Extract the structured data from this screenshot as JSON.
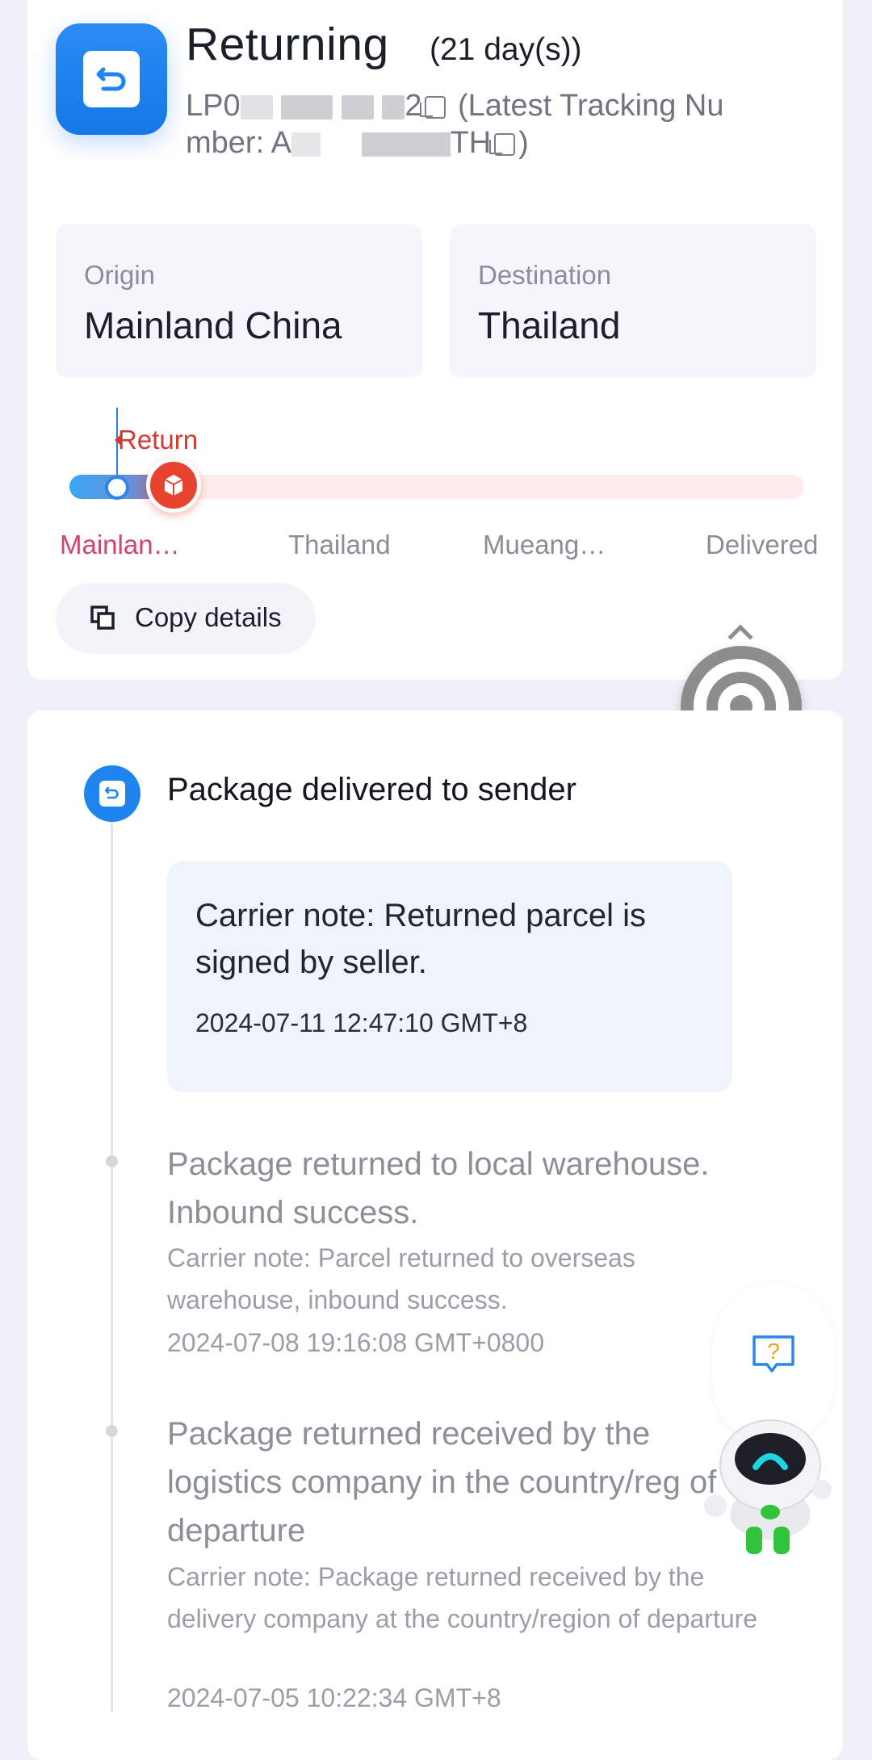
{
  "status": {
    "title": "Returning",
    "days": "(21 day(s))",
    "tracking_prefix": "LP0",
    "tracking_suffix_digit": "2",
    "latest_label": "(Latest Tracking Nu",
    "latest_label_cont": "mber: A",
    "latest_suffix": "TH",
    "latest_close": ")"
  },
  "origin": {
    "label": "Origin",
    "value": "Mainland China"
  },
  "destination": {
    "label": "Destination",
    "value": "Thailand"
  },
  "progress": {
    "fraction": 0.11,
    "return_tag": "Return",
    "stops": [
      "Mainlan…",
      "Thailand",
      "Mueang…",
      "Delivered"
    ],
    "active_color": "#d24467",
    "inactive_color": "#8a8e98"
  },
  "actions": {
    "copy_details": "Copy details"
  },
  "timeline": {
    "current": {
      "title": "Package delivered to sender",
      "note": "Carrier note: Returned parcel is signed by seller.",
      "time": "2024-07-11 12:47:10 GMT+8"
    },
    "events": [
      {
        "title": "Package returned to local warehouse. Inbound success.",
        "note": "Carrier note: Parcel returned to overseas warehouse, inbound success.",
        "time": "2024-07-08 19:16:08 GMT+0800"
      },
      {
        "title": "Package returned received by the logistics company in the country/reg of departure",
        "note": "Carrier note: Package returned received by the delivery company at the country/region of departure",
        "time": "2024-07-05 10:22:34 GMT+8"
      }
    ]
  },
  "colors": {
    "accent": "#1e84ee",
    "return": "#d33a31"
  },
  "icons": [
    "return-icon",
    "copy-icon",
    "target-icon",
    "help-icon",
    "robot-mascot"
  ]
}
